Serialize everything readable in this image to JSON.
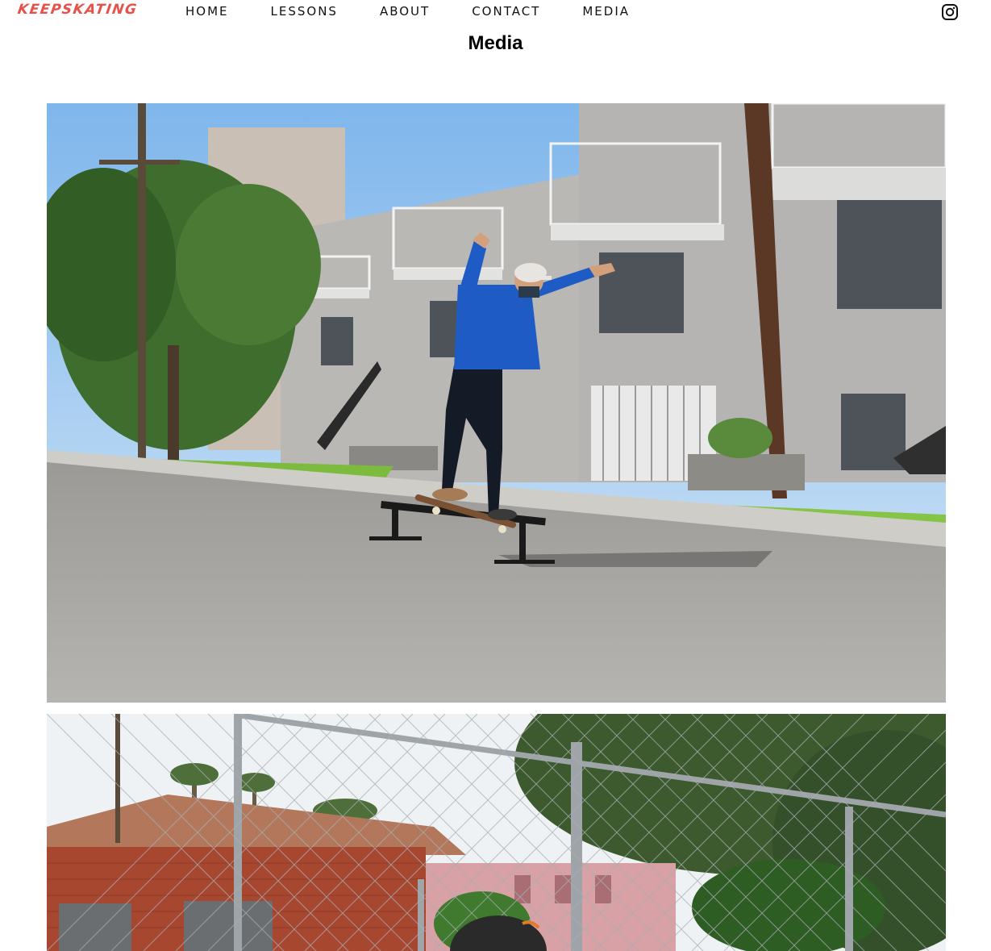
{
  "brand": "KEEPSKATING",
  "nav": {
    "items": [
      {
        "label": "HOME"
      },
      {
        "label": "LESSONS"
      },
      {
        "label": "ABOUT"
      },
      {
        "label": "CONTACT"
      },
      {
        "label": "MEDIA"
      }
    ],
    "social_icon": "instagram-icon"
  },
  "page_title": "Media",
  "colors": {
    "brand": "#e8504a",
    "text": "#111111",
    "background": "#ffffff"
  }
}
